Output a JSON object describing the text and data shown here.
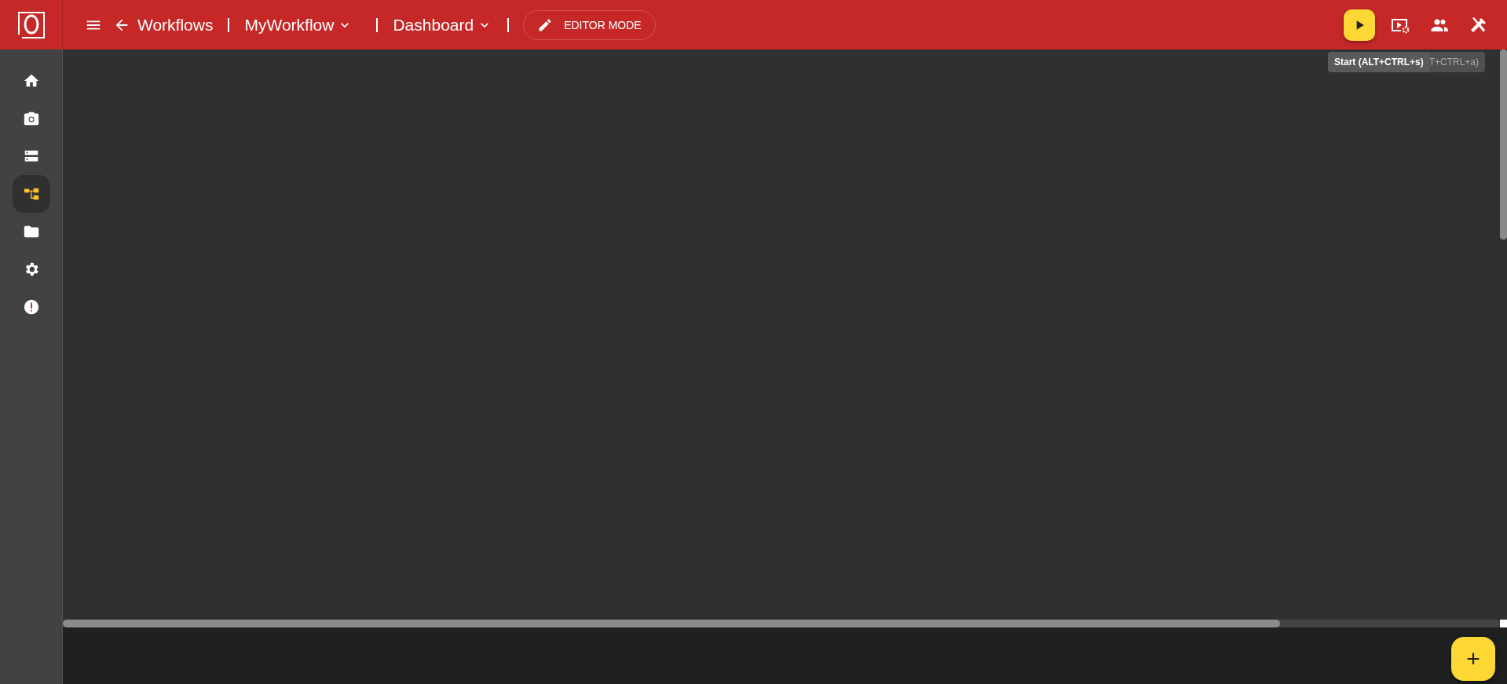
{
  "header": {
    "breadcrumbs": [
      {
        "label": "Workflows",
        "kind": "back"
      },
      {
        "label": "MyWorkflow",
        "kind": "dropdown"
      },
      {
        "label": "Dashboard",
        "kind": "dropdown"
      }
    ],
    "mode_button": {
      "label": "EDITOR MODE"
    },
    "actions": [
      {
        "kind": "play",
        "selected": true
      },
      {
        "kind": "preview",
        "selected": false
      },
      {
        "kind": "users",
        "selected": false
      },
      {
        "kind": "tools",
        "selected": false
      }
    ]
  },
  "tooltips": [
    {
      "text": "Start (ALT+CTRL+s)",
      "kind": "front"
    },
    {
      "text": "T+CTRL+a)",
      "kind": "behind"
    }
  ],
  "sidebar": {
    "items": [
      {
        "kind": "home",
        "selected": false
      },
      {
        "kind": "camera",
        "selected": false
      },
      {
        "kind": "storage",
        "selected": false
      },
      {
        "kind": "workflow",
        "selected": true
      },
      {
        "kind": "folder",
        "selected": false
      },
      {
        "kind": "settings",
        "selected": false
      },
      {
        "kind": "alert",
        "selected": false
      }
    ]
  },
  "fab": {
    "label": "+"
  }
}
